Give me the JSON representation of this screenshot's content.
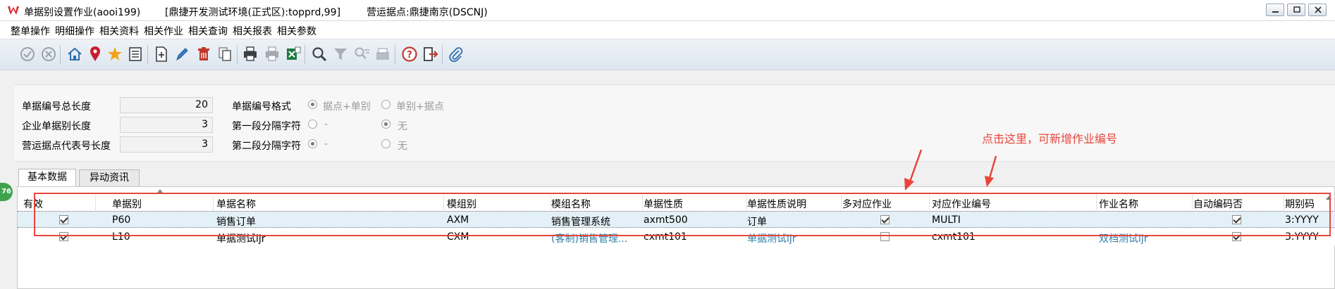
{
  "window": {
    "title": "单据别设置作业(aooi199)",
    "environment": "[鼎捷开发测试环境(正式区):topprd,99]",
    "site": "营运据点:鼎捷南京(DSCNJ)"
  },
  "menu": {
    "items": [
      "整单操作",
      "明细操作",
      "相关资料",
      "相关作业",
      "相关查询",
      "相关报表",
      "相关参数"
    ]
  },
  "form": {
    "total_length_label": "单据编号总长度",
    "total_length_value": "20",
    "company_length_label": "企业单据别长度",
    "company_length_value": "3",
    "site_code_length_label": "营运据点代表号长度",
    "site_code_length_value": "3",
    "format_label": "单据编号格式",
    "format_option1": "据点+单别",
    "format_option2": "单别+据点",
    "sep1_label": "第一段分隔字符",
    "sep1_option1": "-",
    "sep1_option2": "无",
    "sep2_label": "第二段分隔字符",
    "sep2_option1": "-",
    "sep2_option2": "无"
  },
  "annotation": {
    "text": "点击这里，可新增作业编号"
  },
  "tabs": {
    "basic": "基本数据",
    "change": "异动资讯"
  },
  "side_badge": "76",
  "grid": {
    "columns": [
      "有效",
      "单据别",
      "单据名称",
      "模组别",
      "模组名称",
      "单据性质",
      "单据性质说明",
      "多对应作业",
      "对应作业编号",
      "作业名称",
      "自动编码否",
      "期别码"
    ],
    "rows": [
      {
        "valid": true,
        "doc_type": "P60",
        "doc_name": "销售订单",
        "module": "AXM",
        "module_name": "销售管理系统",
        "nature": "axmt500",
        "nature_desc": "订单",
        "multi": true,
        "job_no": "MULTI",
        "job_name": "",
        "auto_code": true,
        "period": "3:YYYY"
      },
      {
        "valid": true,
        "doc_type": "L10",
        "doc_name": "单据测试ljr",
        "module": "CXM",
        "module_name": "(客制)销售管理...",
        "nature": "cxmt101",
        "nature_desc": "单据测试ljr",
        "multi": false,
        "job_no": "cxmt101",
        "job_name": "双档测试ljr",
        "auto_code": true,
        "period": "3:YYYY"
      }
    ]
  }
}
